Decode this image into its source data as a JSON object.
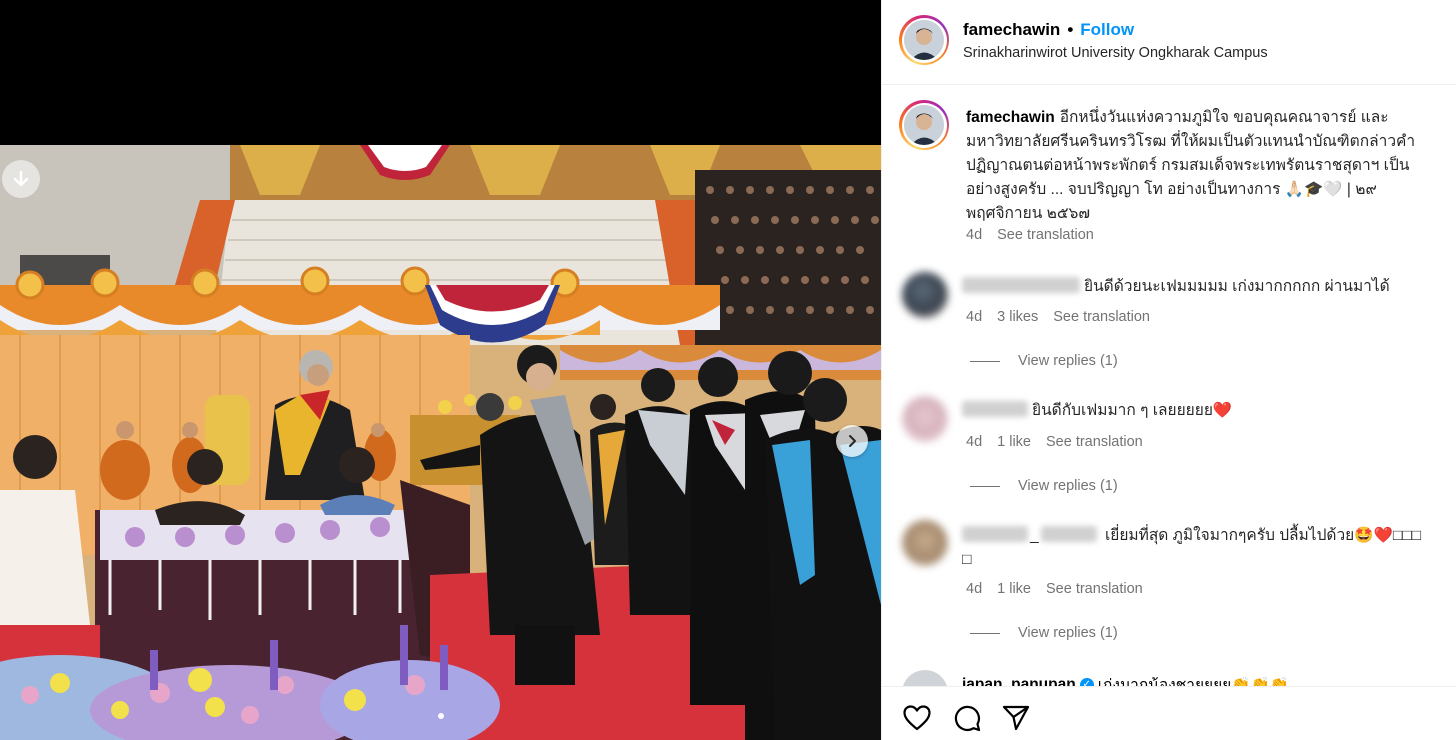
{
  "post": {
    "username": "famechawin",
    "follow_label": "Follow",
    "separator": "•",
    "location": "Srinakharinwirot University Ongkharak Campus"
  },
  "caption": {
    "username": "famechawin",
    "text": "อีกหนึ่งวันแห่งความภูมิใจ ขอบคุณคณาจารย์ และมหาวิทยาลัยศรีนครินทรวิโรฒ ที่ให้ผมเป็นตัวแทนนำบัณฑิตกล่าวคำปฏิญาณตนต่อหน้าพระพักตร์ กรมสมเด็จพระเทพรัตนราชสุดาฯ เป็นอย่างสูงครับ ... จบปริญญา โท อย่างเป็นทางการ 🙏🏻🎓🤍 | ๒๙ พฤศจิกายน ๒๕๖๗",
    "time": "4d",
    "see_translation": "See translation"
  },
  "comments": [
    {
      "text": "ยินดีด้วยนะเฟมมมมม เก่งมากกกกก ผ่านมาได้",
      "time": "4d",
      "likes": "3 likes",
      "see_translation": "See translation",
      "view_replies": "View replies (1)"
    },
    {
      "text": "ยินดีกับเฟมมาก ๆ เลยยยยย",
      "emoji": "❤️",
      "time": "4d",
      "likes": "1 like",
      "see_translation": "See translation",
      "view_replies": "View replies (1)"
    },
    {
      "name_suffix": "_",
      "text": "เยี่ยมที่สุด ภูมิใจมากๆครับ ปลื้มไปด้วย",
      "emoji": "🤩❤️",
      "tail": "□□□",
      "tail2": "□",
      "time": "4d",
      "likes": "1 like",
      "see_translation": "See translation",
      "view_replies": "View replies (1)"
    }
  ],
  "partial_comment": {
    "username": "japan_panupan",
    "text": "เก่งมากน้องชายยยย👏👏👏"
  },
  "icons": {
    "download": "download-arrow-icon",
    "next": "chevron-right-icon",
    "like": "heart-icon",
    "comment": "comment-bubble-icon",
    "share": "paper-plane-icon"
  },
  "colors": {
    "follow": "#0095f6",
    "secondary_text": "#737373"
  },
  "carousel": {
    "current": 1,
    "total": 1
  }
}
